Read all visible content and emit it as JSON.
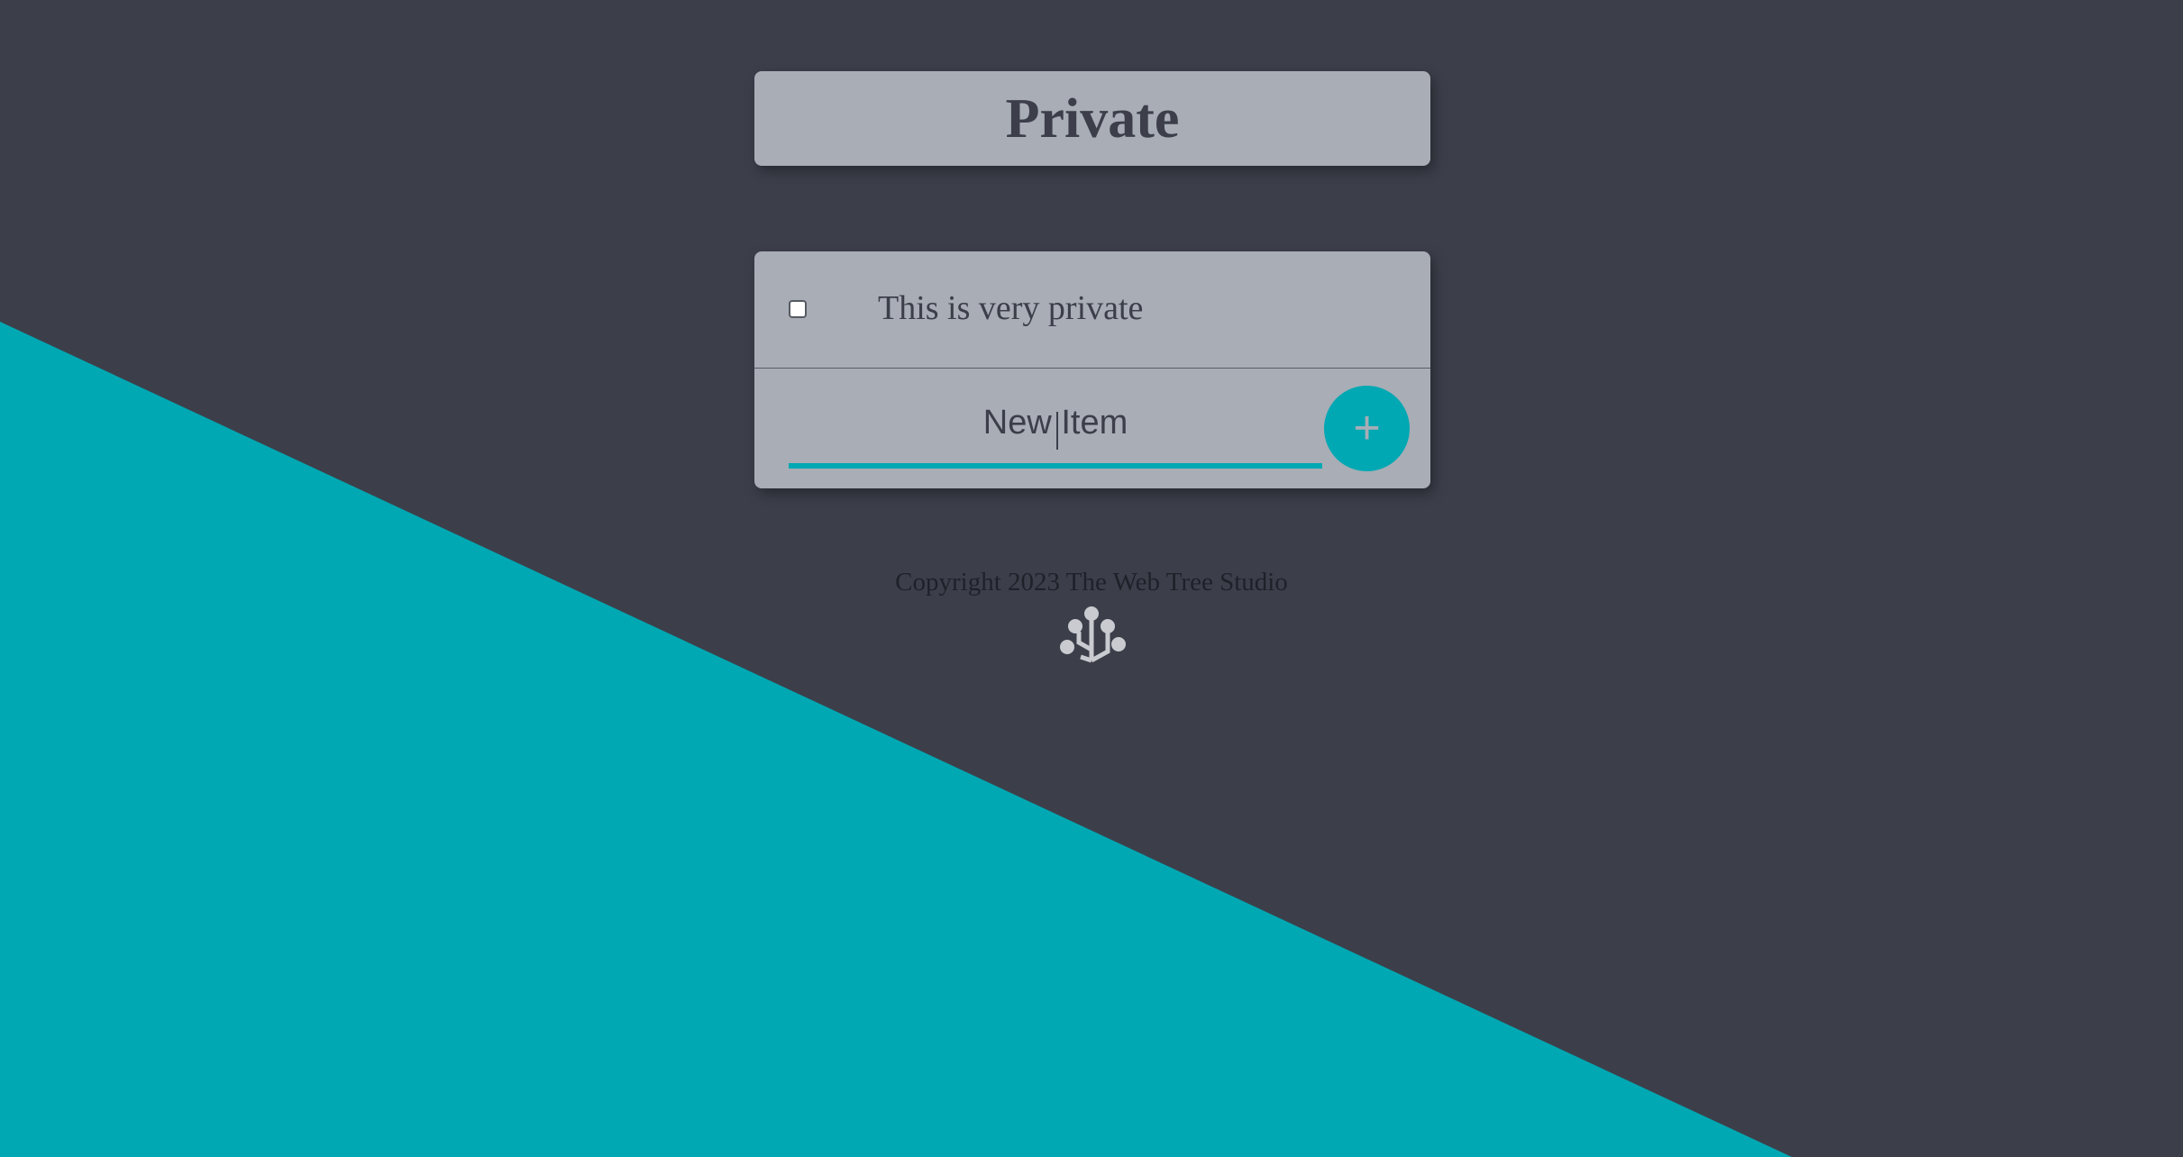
{
  "header": {
    "title": "Private"
  },
  "items": [
    {
      "text": "This is very private",
      "checked": false
    }
  ],
  "new_item": {
    "placeholder": "New Item",
    "add_label": "+"
  },
  "footer": {
    "copyright": "Copyright 2023 The Web Tree Studio",
    "logo_icon": "tree-logo-icon"
  },
  "colors": {
    "background": "#3c3f4a",
    "accent": "#00a8b3",
    "card": "#a8adb6",
    "text": "#3c3f4a"
  }
}
